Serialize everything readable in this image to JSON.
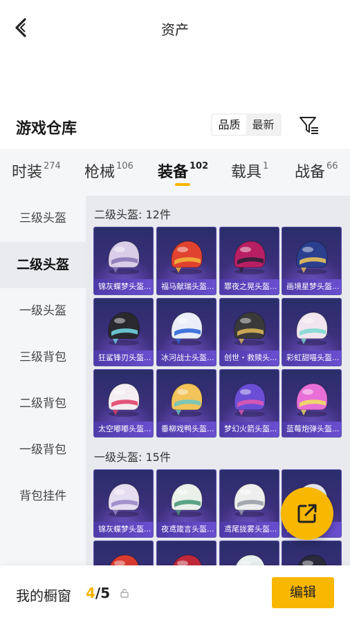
{
  "header": {
    "title": "资产"
  },
  "warehouse": {
    "title": "游戏仓库",
    "sort_options": [
      "品质",
      "最新"
    ],
    "active_sort": "品质"
  },
  "tabs": [
    {
      "label": "时装",
      "count": "274"
    },
    {
      "label": "枪械",
      "count": "106"
    },
    {
      "label": "装备",
      "count": "102"
    },
    {
      "label": "载具",
      "count": "1"
    },
    {
      "label": "战备",
      "count": "66"
    }
  ],
  "active_tab": "装备",
  "sidebar": {
    "items": [
      {
        "label": "三级头盔"
      },
      {
        "label": "二级头盔"
      },
      {
        "label": "一级头盔"
      },
      {
        "label": "三级背包"
      },
      {
        "label": "二级背包"
      },
      {
        "label": "一级背包"
      },
      {
        "label": "背包挂件"
      }
    ],
    "active": "二级头盔"
  },
  "sections": [
    {
      "title": "二级头盔: 12件",
      "items": [
        {
          "name": "锦灰蝶梦头盔...",
          "shell": "#d9cde8",
          "accent": "#8a78b8",
          "icon": "butterfly-helmet-icon"
        },
        {
          "name": "福马献瑞头盔...",
          "shell": "#e0422f",
          "accent": "#f0b33a",
          "icon": "horse-helmet-icon"
        },
        {
          "name": "罪夜之晃头盔...",
          "shell": "#b81f63",
          "accent": "#2a2236",
          "icon": "night-helmet-icon"
        },
        {
          "name": "画境星梦头盔...",
          "shell": "#2b3f8f",
          "accent": "#e8c15a",
          "icon": "star-helmet-icon"
        },
        {
          "name": "狂鲨锋刃头盔...",
          "shell": "#2a2a2e",
          "accent": "#6fd1e0",
          "icon": "shark-helmet-icon"
        },
        {
          "name": "冰河战士头盔...",
          "shell": "#e9eef8",
          "accent": "#2f67d8",
          "icon": "glacier-helmet-icon"
        },
        {
          "name": "创世・救赎头...",
          "shell": "#3a3a3a",
          "accent": "#d9b35a",
          "icon": "genesis-helmet-icon"
        },
        {
          "name": "彩虹甜喵头盔...",
          "shell": "#f1e6ef",
          "accent": "#7fd9d0",
          "icon": "cat-helmet-icon"
        },
        {
          "name": "太空嘟嘟头盔...",
          "shell": "#f4eef2",
          "accent": "#e2426a",
          "icon": "space-helmet-icon"
        },
        {
          "name": "垂柳戏鸭头盔...",
          "shell": "#f2c45a",
          "accent": "#6fc7c0",
          "icon": "duck-helmet-icon"
        },
        {
          "name": "梦幻火箭头盔...",
          "shell": "#6b4ed6",
          "accent": "#e058b0",
          "icon": "rocket-helmet-icon"
        },
        {
          "name": "蓝莓炮弹头盔...",
          "shell": "#e86fd8",
          "accent": "#f0e060",
          "icon": "berry-helmet-icon"
        }
      ]
    },
    {
      "title": "一级头盔: 15件",
      "items": [
        {
          "name": "锦灰蝶梦头盔...",
          "shell": "#e5ddf0",
          "accent": "#9a88c8",
          "icon": "butterfly-helmet-icon"
        },
        {
          "name": "夜鸢箴言头盔...",
          "shell": "#eaf0ea",
          "accent": "#4a9a7a",
          "icon": "kite-helmet-icon"
        },
        {
          "name": "鸢尾拢雾头盔...",
          "shell": "#eeeeee",
          "accent": "#9aa0a8",
          "icon": "iris-helmet-icon"
        },
        {
          "name": "菠萝头盔...",
          "shell": "#e9e9ef",
          "accent": "#b8c84a",
          "icon": "pineapple-helmet-icon"
        },
        {
          "name": "",
          "shell": "#d93b2f",
          "accent": "#2a2a2a",
          "icon": "red-helmet-icon"
        },
        {
          "name": "",
          "shell": "#c0283a",
          "accent": "#3a2a2a",
          "icon": "crimson-helmet-icon"
        },
        {
          "name": "",
          "shell": "#e8f0f0",
          "accent": "#5ab0a0",
          "icon": "mint-helmet-icon"
        },
        {
          "name": "",
          "shell": "#2a2a3a",
          "accent": "#e05aa0",
          "icon": "dark-helmet-icon"
        }
      ]
    }
  ],
  "bottom": {
    "label": "我的橱窗",
    "current": "4",
    "separator": "/",
    "total": "5",
    "edit_label": "编辑"
  },
  "colors": {
    "accent": "#f8b700",
    "card_bg": "#3b2f7a"
  }
}
